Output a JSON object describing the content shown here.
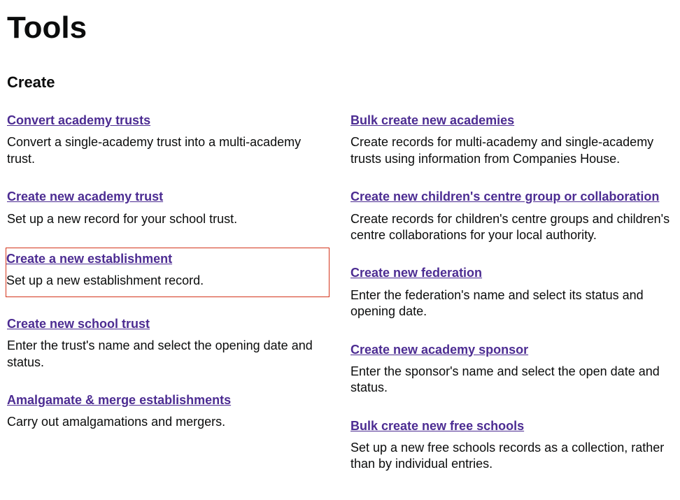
{
  "page": {
    "title": "Tools",
    "section": "Create"
  },
  "leftColumn": [
    {
      "link": "Convert academy trusts",
      "desc": "Convert a single-academy trust into a multi-academy trust.",
      "highlighted": false
    },
    {
      "link": "Create new academy trust",
      "desc": "Set up a new record for your school trust.",
      "highlighted": false
    },
    {
      "link": "Create a new establishment",
      "desc": "Set up a new establishment record.",
      "highlighted": true
    },
    {
      "link": "Create new school trust",
      "desc": "Enter the trust's name and select the opening date and status.",
      "highlighted": false
    },
    {
      "link": "Amalgamate & merge establishments",
      "desc": "Carry out amalgamations and mergers.",
      "highlighted": false
    }
  ],
  "rightColumn": [
    {
      "link": "Bulk create new academies",
      "desc": "Create records for multi-academy and single-academy trusts using information from Companies House.",
      "highlighted": false
    },
    {
      "link": "Create new children's centre group or collaboration",
      "desc": "Create records for children's centre groups and children's centre collaborations for your local authority.",
      "highlighted": false
    },
    {
      "link": "Create new federation",
      "desc": "Enter the federation's name and select its status and opening date.",
      "highlighted": false
    },
    {
      "link": "Create new academy sponsor",
      "desc": "Enter the sponsor's name and select the open date and status.",
      "highlighted": false
    },
    {
      "link": "Bulk create new free schools",
      "desc": "Set up a new free schools records as a collection, rather than by individual entries.",
      "highlighted": false
    }
  ]
}
